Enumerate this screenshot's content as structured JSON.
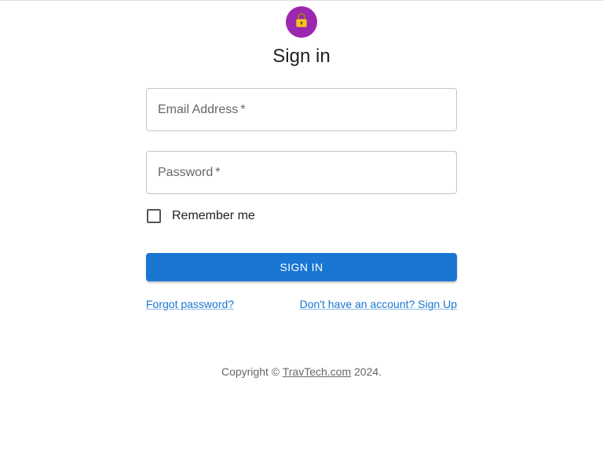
{
  "header": {
    "title": "Sign in",
    "avatar_icon": "lock-icon",
    "avatar_color": "#9c27b0"
  },
  "form": {
    "email": {
      "label": "Email Address",
      "required_mark": "*",
      "value": ""
    },
    "password": {
      "label": "Password",
      "required_mark": "*",
      "value": ""
    },
    "remember_label": "Remember me",
    "remember_checked": false,
    "submit_label": "SIGN IN",
    "accent_color": "#1976d2"
  },
  "links": {
    "forgot": "Forgot password?",
    "signup": "Don't have an account? Sign Up"
  },
  "footer": {
    "prefix": "Copyright © ",
    "brand": "TravTech.com",
    "suffix": " 2024."
  }
}
